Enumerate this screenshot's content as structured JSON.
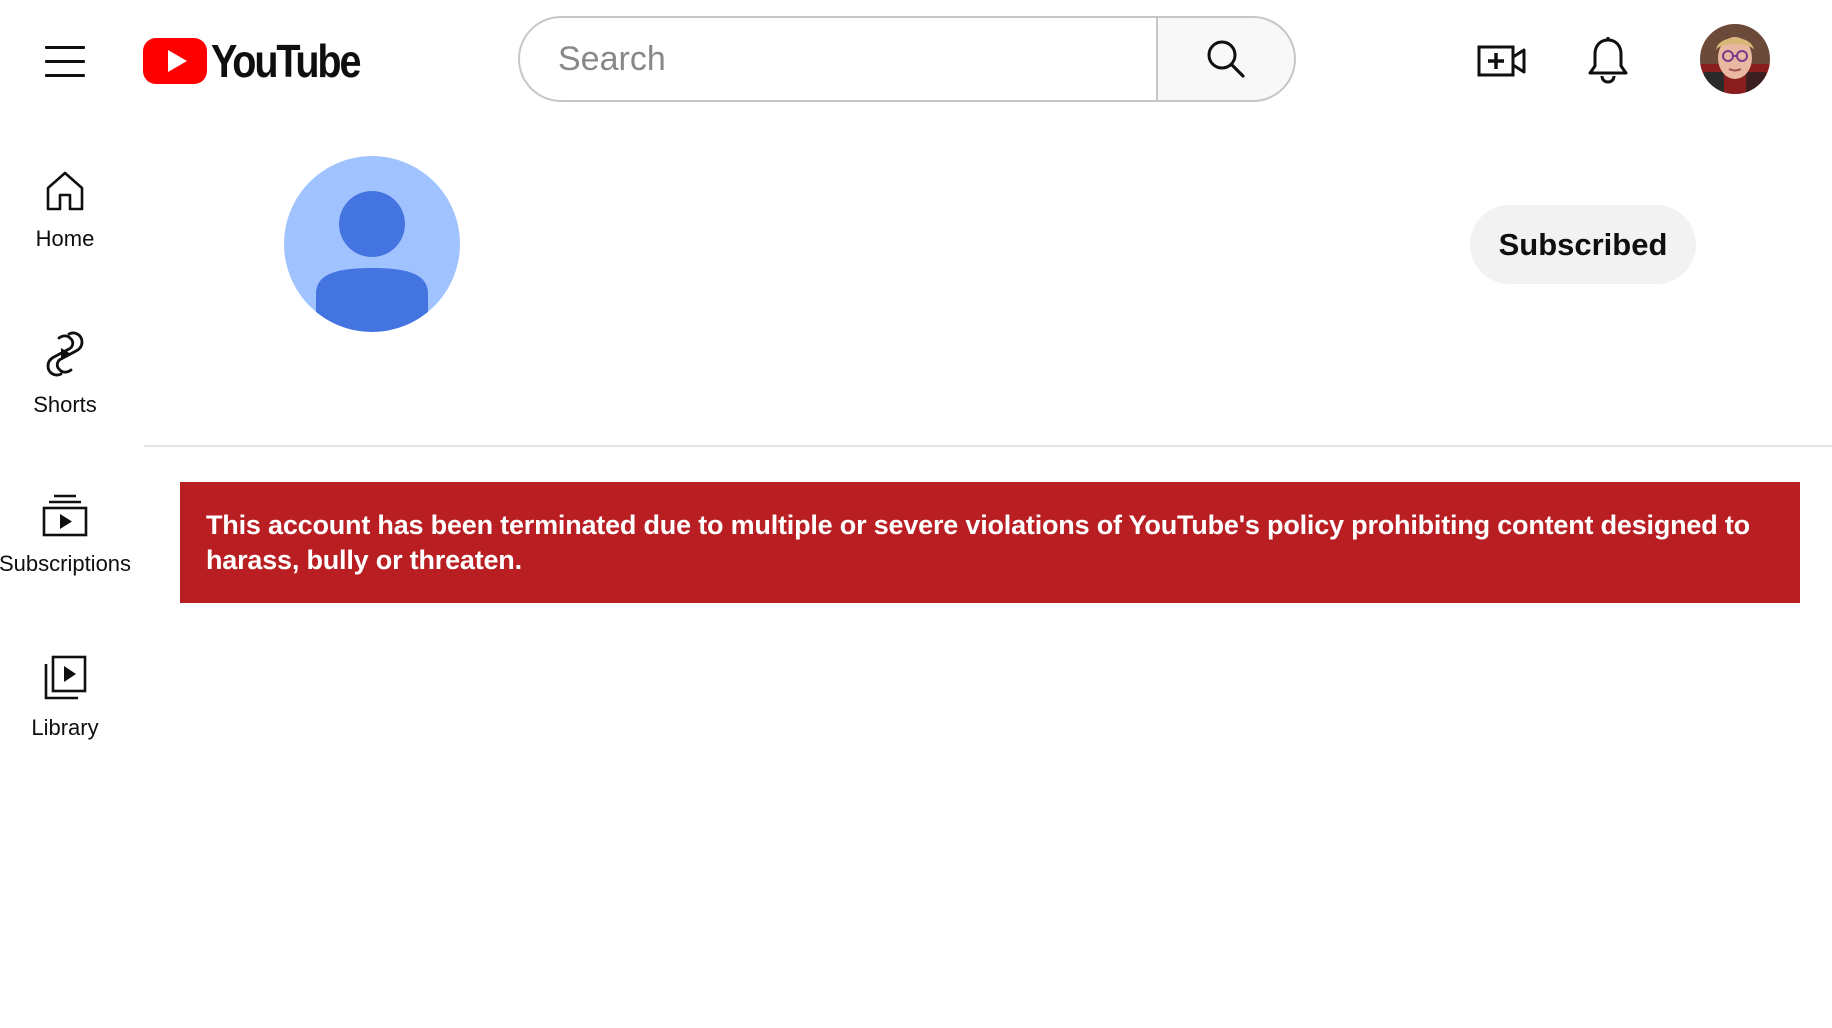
{
  "header": {
    "logo_text": "YouTube",
    "search": {
      "placeholder": "Search",
      "value": ""
    }
  },
  "sidebar": {
    "items": [
      {
        "label": "Home",
        "icon": "home-icon"
      },
      {
        "label": "Shorts",
        "icon": "shorts-icon"
      },
      {
        "label": "Subscriptions",
        "icon": "subscriptions-icon"
      },
      {
        "label": "Library",
        "icon": "library-icon"
      }
    ]
  },
  "channel": {
    "subscribe_label": "Subscribed"
  },
  "alert": {
    "message": "This account has been terminated due to multiple or severe violations of YouTube's policy prohibiting content designed to harass, bully or threaten."
  },
  "colors": {
    "brand_red": "#ff0000",
    "alert_bg": "#b91e22",
    "avatar_bg": "#a0c3ff",
    "avatar_fg": "#4374e0",
    "chip_bg": "#f2f2f2"
  }
}
